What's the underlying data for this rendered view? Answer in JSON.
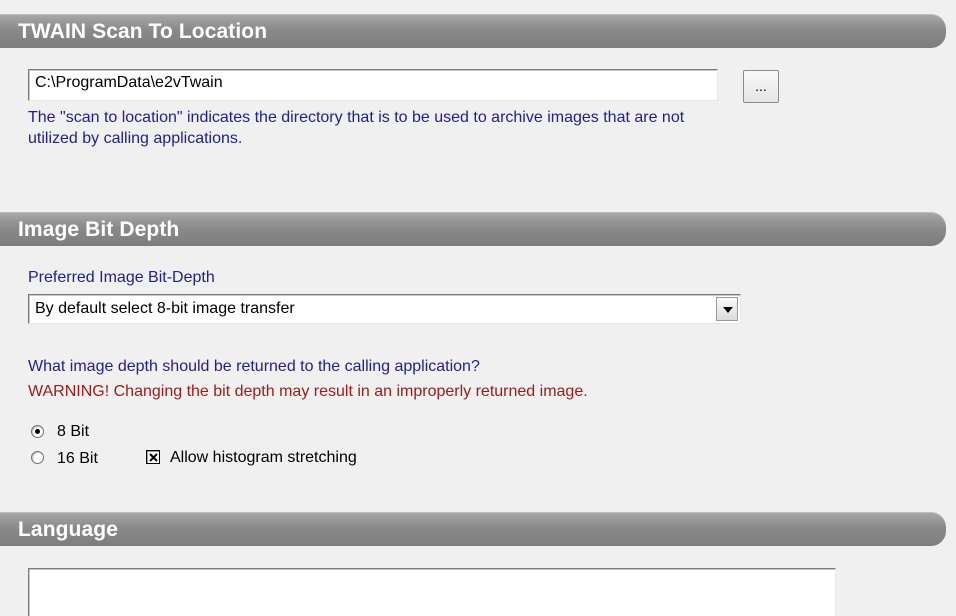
{
  "sections": {
    "scan_location": {
      "title": "TWAIN Scan To Location",
      "path_value": "C:\\ProgramData\\e2vTwain",
      "browse_label": "...",
      "description": "The \"scan to location\" indicates the directory that is to be used to archive images that are not utilized by calling applications."
    },
    "bit_depth": {
      "title": "Image Bit Depth",
      "preferred_label": "Preferred Image Bit-Depth",
      "selected_option": "By default select 8-bit image transfer",
      "question": "What image depth should be returned to the calling application?",
      "warning": "WARNING! Changing the bit depth may result in an improperly returned image.",
      "options": [
        {
          "label": "8 Bit",
          "checked": true
        },
        {
          "label": "16 Bit",
          "checked": false
        }
      ],
      "histogram_label": "Allow histogram stretching",
      "histogram_checked": true
    },
    "language": {
      "title": "Language"
    }
  },
  "colors": {
    "info_text": "#1f1f8f",
    "warning_text": "#9b1b1b",
    "header_bg": "#8a8a8a",
    "panel_bg": "#f0f0f0"
  }
}
